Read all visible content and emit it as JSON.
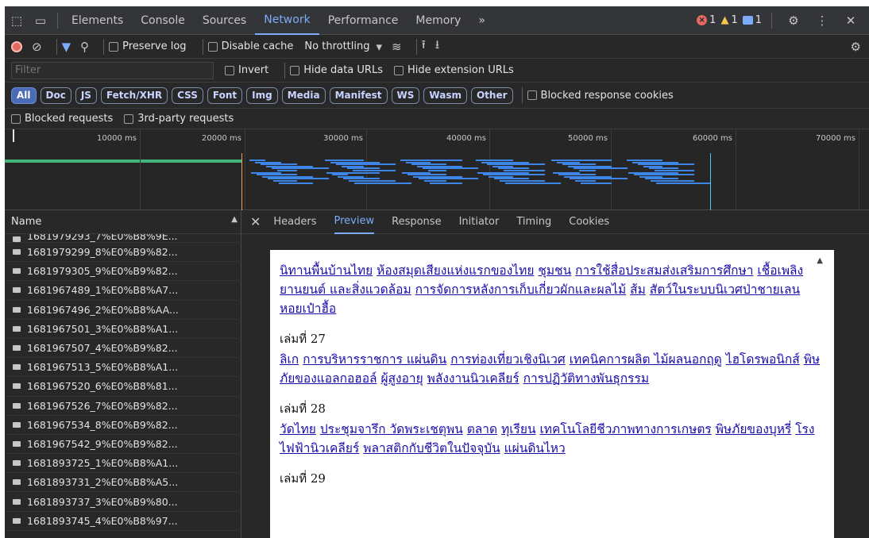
{
  "devtools": {
    "tabs": [
      "Elements",
      "Console",
      "Sources",
      "Network",
      "Performance",
      "Memory"
    ],
    "active_tab": "Network",
    "more_tabs": "»",
    "status": {
      "errors": "1",
      "warnings": "1",
      "info": "1"
    }
  },
  "toolbar": {
    "preserve_log": "Preserve log",
    "disable_cache": "Disable cache",
    "throttling": "No throttling",
    "dropdown": "▾"
  },
  "filterbar": {
    "placeholder": "Filter",
    "invert": "Invert",
    "hide_data_urls": "Hide data URLs",
    "hide_ext_urls": "Hide extension URLs"
  },
  "type_filters": [
    "All",
    "Doc",
    "JS",
    "Fetch/XHR",
    "CSS",
    "Font",
    "Img",
    "Media",
    "Manifest",
    "WS",
    "Wasm",
    "Other"
  ],
  "active_type_filter": "All",
  "blocked_cookies": "Blocked response cookies",
  "blocked_requests": "Blocked requests",
  "third_party": "3rd-party requests",
  "timeline": {
    "ticks": [
      "10000 ms",
      "20000 ms",
      "30000 ms",
      "40000 ms",
      "50000 ms",
      "60000 ms",
      "70000 ms"
    ]
  },
  "name_panel": {
    "header": "Name",
    "rows": [
      "1681979293_7%E0%B8%9E...",
      "1681979299_8%E0%B9%82...",
      "1681979305_9%E0%B9%82...",
      "1681967489_1%E0%B8%A7...",
      "1681967496_2%E0%B8%AA...",
      "1681967501_3%E0%B8%A1...",
      "1681967507_4%E0%B9%82...",
      "1681967513_5%E0%B8%A1...",
      "1681967520_6%E0%B8%81...",
      "1681967526_7%E0%B9%82...",
      "1681967534_8%E0%B9%82...",
      "1681967542_9%E0%B9%82...",
      "1681893725_1%E0%B8%A1...",
      "1681893731_2%E0%B8%A5...",
      "1681893737_3%E0%B9%80...",
      "1681893745_4%E0%B8%97..."
    ]
  },
  "preview_tabs": [
    "Headers",
    "Preview",
    "Response",
    "Initiator",
    "Timing",
    "Cookies"
  ],
  "active_preview_tab": "Preview",
  "document": {
    "sections": [
      {
        "heading": "",
        "links": [
          "นิทานพื้นบ้านไทย",
          "ห้องสมุดเสียงแห่งแรกของไทย",
          "ชุมชน",
          "การใช้สื่อประสมส่งเสริมการศึกษา",
          "เชื้อเพลิง ยานยนต์ และสิ่งแวดล้อม",
          "การจัดการหลังการเก็บเกี่ยวผักและผลไม้",
          "ส้ม",
          "สัตว์ในระบบนิเวศป่าชายเลน",
          "หอยเป๋าฮื้อ"
        ]
      },
      {
        "heading": "เล่มที่ 27",
        "links": [
          "ลิเก",
          "การบริหารราชการ แผ่นดิน",
          "การท่องเที่ยวเชิงนิเวศ",
          "เทคนิคการผลิต ไม้ผลนอกฤดู",
          "ไฮโดรพอนิกส์",
          "พิษภัยของแอลกอฮอล์",
          "ผู้สูงอายุ",
          "พลังงานนิวเคลียร์",
          "การปฏิวัติทางพันธุกรรม"
        ]
      },
      {
        "heading": "เล่มที่ 28",
        "links": [
          "วัดไทย",
          "ประชุมจารึก วัดพระเชตุพน",
          "ตลาด",
          "ทุเรียน",
          "เทคโนโลยีชีวภาพทางการเกษตร",
          "พิษภัยของบุหรี่",
          "โรงไฟฟ้านิวเคลียร์",
          "พลาสติกกับชีวิตในปัจจุบัน",
          "แผ่นดินไหว"
        ]
      },
      {
        "heading": "เล่มที่ 29",
        "links": []
      }
    ]
  }
}
